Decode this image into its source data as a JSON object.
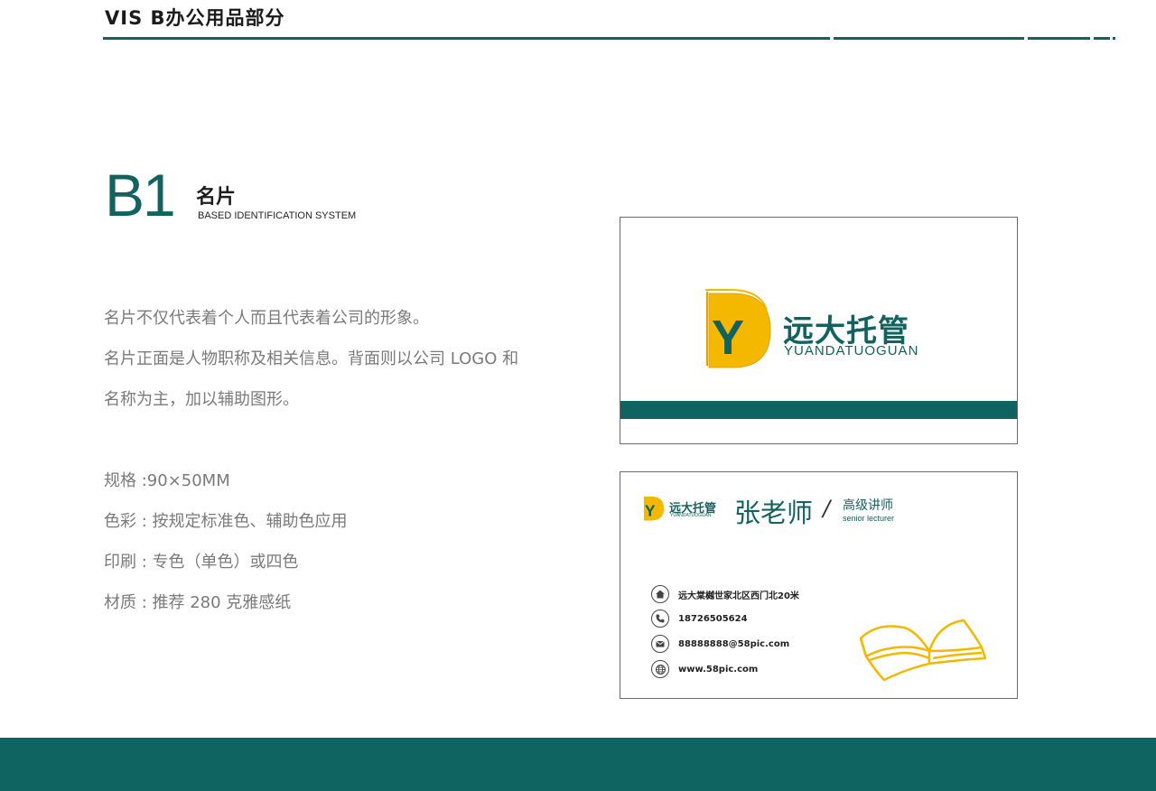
{
  "header": {
    "title": "VIS  B办公用品部分"
  },
  "section": {
    "code": "B1",
    "title": "名片",
    "subtitle": "BASED  IDENTIFICATION SYSTEM"
  },
  "description": {
    "lines": [
      "名片不仅代表着个人而且代表着公司的形象。",
      "名片正面是人物职称及相关信息。背面则以公司 LOGO 和",
      "名称为主，加以辅助图形。"
    ]
  },
  "specs": [
    "规格 :90×50MM",
    "色彩 : 按规定标准色、辅助色应用",
    "印刷 : 专色（单色）或四色",
    "材质 : 推荐 280 克雅感纸"
  ],
  "brand": {
    "name_cn": "远大托管",
    "name_en": "YUANDATUOGUAN",
    "logo_letter": "Y",
    "primary_color": "#12625f",
    "accent_color": "#f5b800"
  },
  "card_front": {
    "person_name": "张老师",
    "separator": "/",
    "job_title_cn": "高级讲师",
    "job_title_en": "senior lecturer",
    "contacts": [
      {
        "icon": "home-icon",
        "text": "远大棠樾世家北区西门北20米"
      },
      {
        "icon": "phone-icon",
        "text": "18726505624"
      },
      {
        "icon": "mail-icon",
        "text": "88888888@58pic.com"
      },
      {
        "icon": "globe-icon",
        "text": "www.58pic.com"
      }
    ]
  }
}
